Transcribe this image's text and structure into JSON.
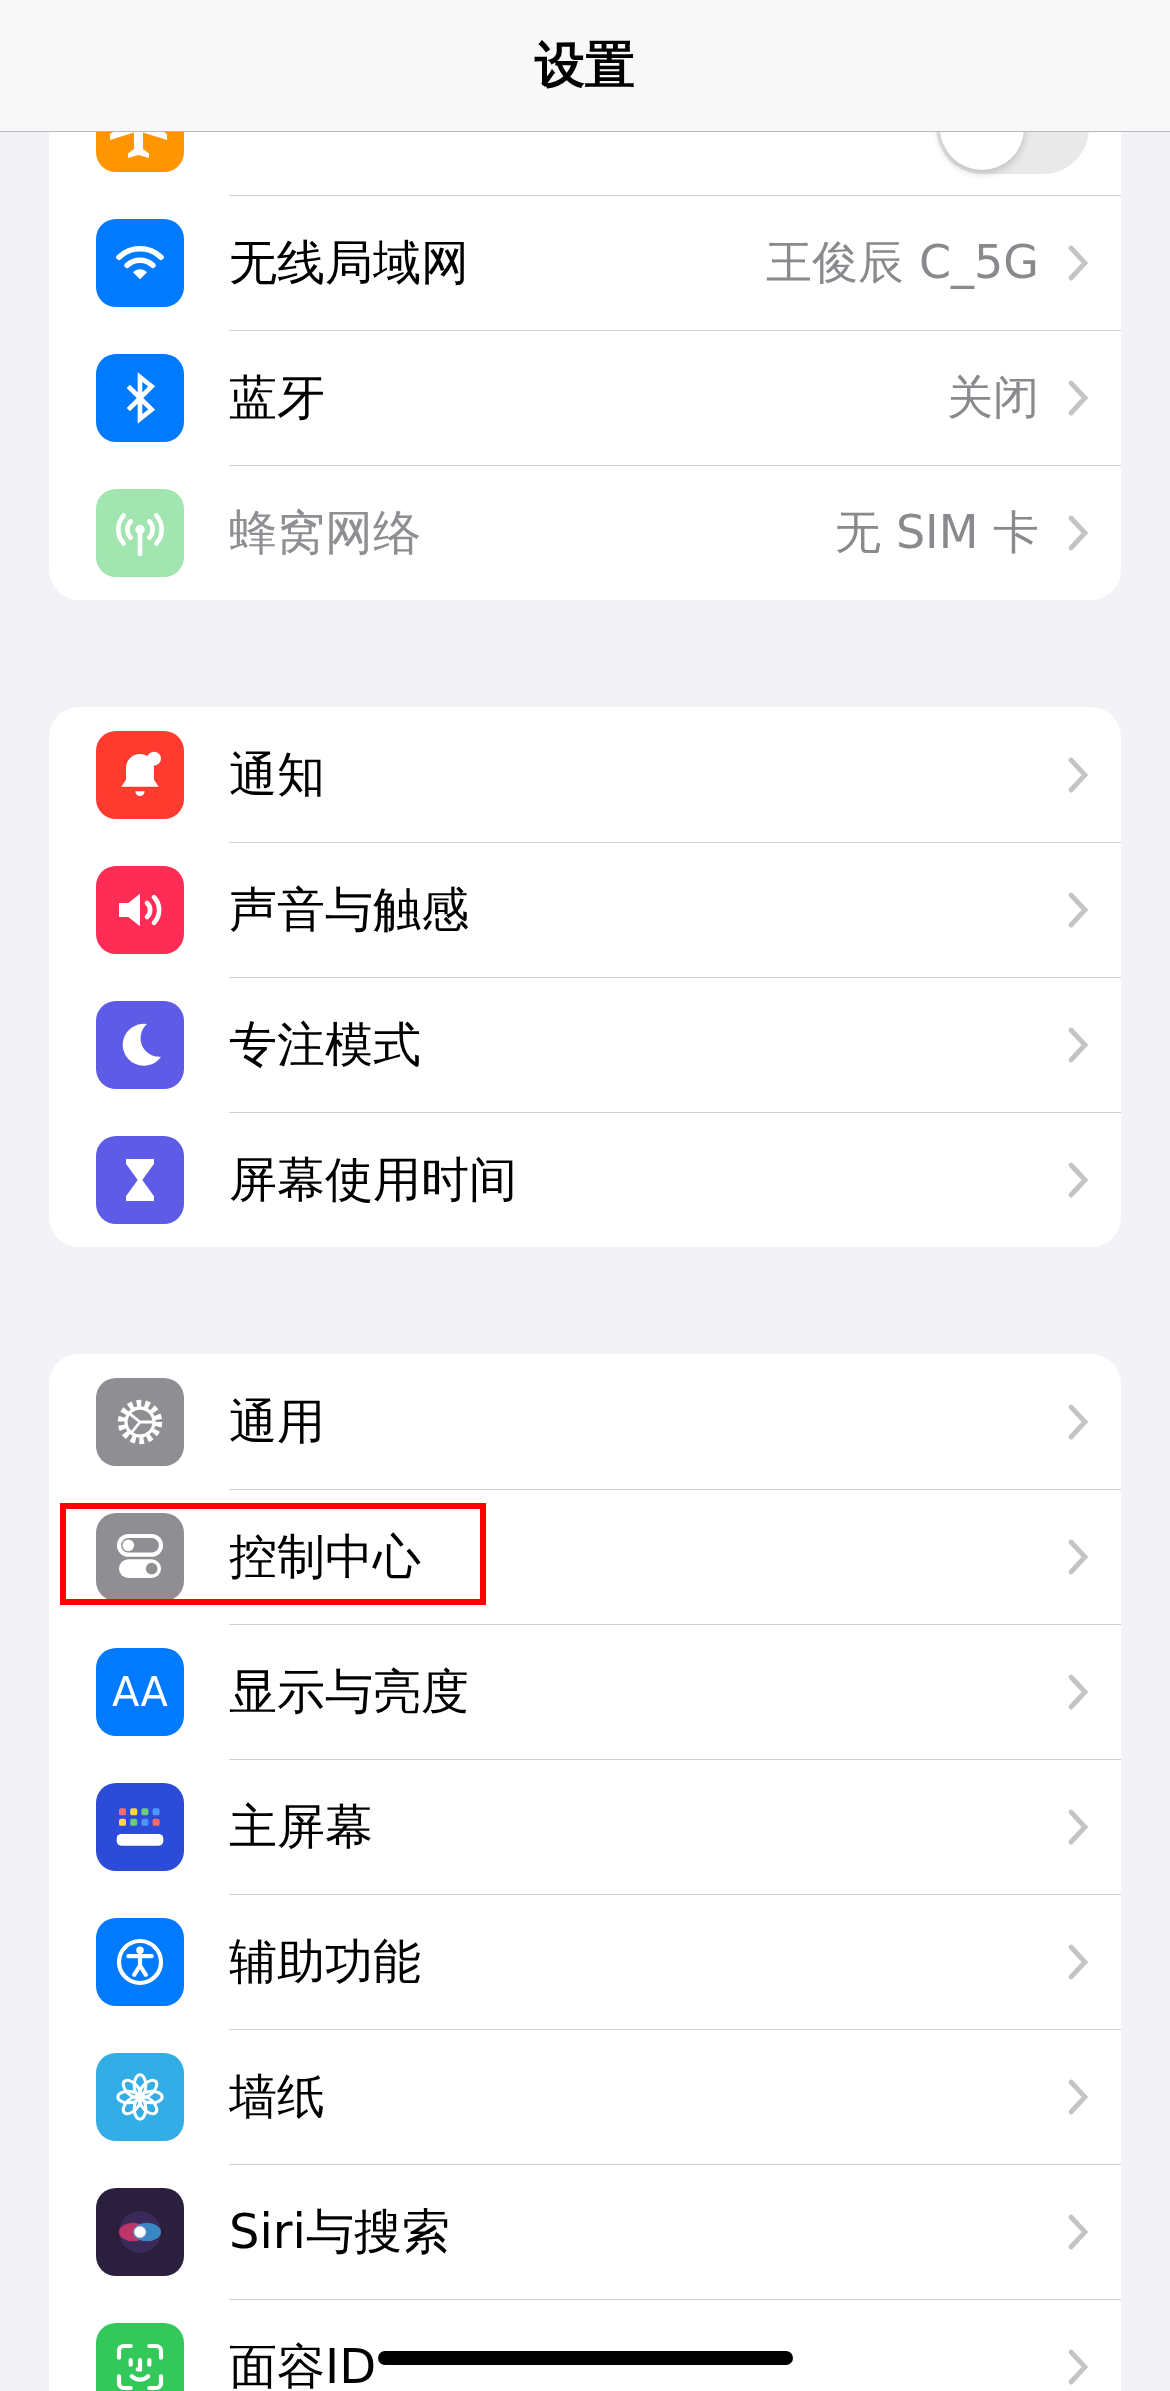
{
  "header": {
    "title": "设置"
  },
  "groups": [
    {
      "items": [
        {
          "kind": "toggle",
          "color": "#ff9500",
          "toggle": {
            "on": false
          }
        },
        {
          "kind": "link",
          "label": "无线局域网",
          "value": "王俊辰 C_5G",
          "color": "#007aff",
          "disabled": false
        },
        {
          "kind": "link",
          "label": "蓝牙",
          "value": "关闭",
          "color": "#007aff",
          "disabled": false
        },
        {
          "kind": "link",
          "label": "蜂窝网络",
          "value": "无 SIM 卡",
          "color": "#a1e6b1",
          "disabled": true
        }
      ]
    },
    {
      "items": [
        {
          "kind": "link",
          "label": "通知",
          "color": "#ff3b30",
          "disabled": false
        },
        {
          "kind": "link",
          "label": "声音与触感",
          "color": "#ff2d55",
          "disabled": false
        },
        {
          "kind": "link",
          "label": "专注模式",
          "color": "#5e5ce6",
          "disabled": false
        },
        {
          "kind": "link",
          "label": "屏幕使用时间",
          "color": "#5e5ce6",
          "disabled": false
        }
      ]
    },
    {
      "items": [
        {
          "kind": "link",
          "label": "通用",
          "color": "#8e8e93",
          "disabled": false
        },
        {
          "kind": "link",
          "label": "控制中心",
          "color": "#8e8e93",
          "disabled": false,
          "highlighted": true
        },
        {
          "kind": "link",
          "label": "显示与亮度",
          "color": "#007aff",
          "disabled": false,
          "icon_text": "AA"
        },
        {
          "kind": "link",
          "label": "主屏幕",
          "color": "#2c4bd8",
          "disabled": false
        },
        {
          "kind": "link",
          "label": "辅助功能",
          "color": "#007aff",
          "disabled": false
        },
        {
          "kind": "link",
          "label": "墙纸",
          "color": "#32ade6",
          "disabled": false
        },
        {
          "kind": "link",
          "label": "Siri与搜索",
          "color": "#2a1f3d",
          "disabled": false
        },
        {
          "kind": "link",
          "label": "面容ID",
          "color": "#34c759",
          "disabled": false
        }
      ]
    }
  ]
}
